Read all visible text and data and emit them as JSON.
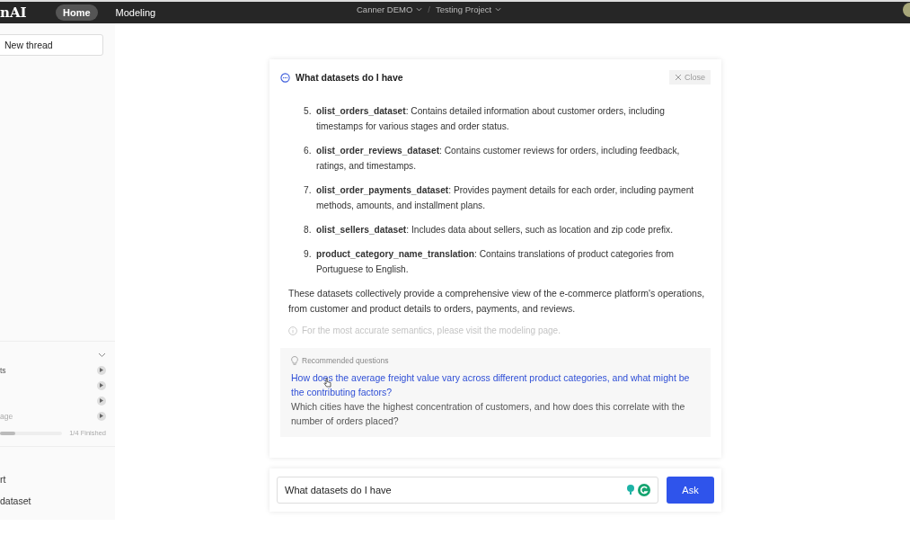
{
  "topbar": {
    "logo": "nAI",
    "tabs": [
      {
        "label": "Home",
        "selected": true
      },
      {
        "label": "Modeling",
        "selected": false
      }
    ],
    "breadcrumbs": [
      "Canner DEMO",
      "Testing Project"
    ],
    "separator": "/"
  },
  "sidebar": {
    "new_thread": "New thread",
    "checklist": {
      "expanded": true,
      "items": [
        {
          "label": "ts",
          "done": false
        },
        {
          "done": false
        },
        {
          "done": false
        },
        {
          "label": "age",
          "done": true
        }
      ],
      "level": 0.25,
      "progress_text": "1/4 Finished"
    },
    "links": [
      "rt",
      "dataset"
    ]
  },
  "answer_card": {
    "title": "What datasets do I have",
    "close": "Close",
    "items": [
      {
        "number": "5.",
        "text": "**olist_orders_dataset**: Contains detailed information about customer orders, including timestamps for various stages and order status."
      },
      {
        "number": "6.",
        "text": "**olist_order_reviews_dataset**: Contains customer reviews for orders, including feedback, ratings, and timestamps."
      },
      {
        "number": "7.",
        "text": "**olist_order_payments_dataset**: Provides payment details for each order, including payment methods, amounts, and installment plans."
      },
      {
        "number": "8.",
        "text": "**olist_sellers_dataset**: Includes data about sellers, such as location and zip code prefix."
      },
      {
        "number": "9.",
        "text": "**product_category_name_translation**: Contains translations of product categories from Portuguese to English."
      }
    ],
    "summary": "These datasets collectively provide a comprehensive view of the e-commerce platform's operations, from customer and product details to orders, payments, and reviews.",
    "hint": "For the most accurate semantics, please visit the modeling page.",
    "recommended": {
      "heading": "Recommended questions",
      "questions": [
        {
          "text": "How does the average freight value vary across different product categories, and what might be the contributing factors?",
          "hovered": true
        },
        {
          "text": "Which cities have the highest concentration of customers, and how does this correlate with the number of orders placed?",
          "hovered": false
        }
      ]
    }
  },
  "ask_bar": {
    "value": "What datasets do I have",
    "button": "Ask"
  }
}
